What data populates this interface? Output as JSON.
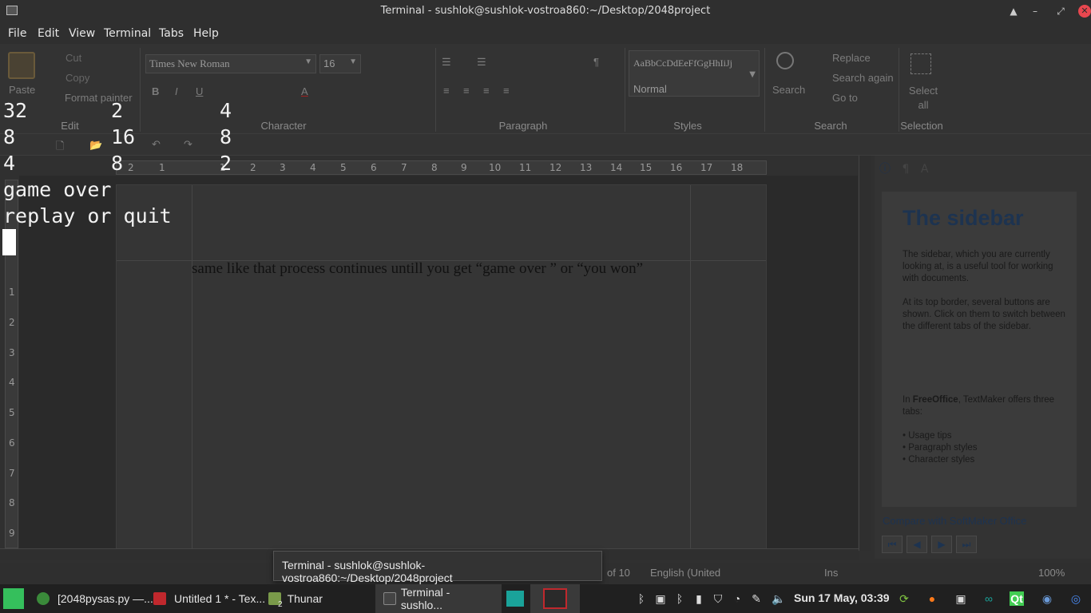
{
  "window": {
    "title": "Terminal - sushlok@sushlok-vostroa860:~/Desktop/2048project"
  },
  "menu": [
    "File",
    "Edit",
    "View",
    "Terminal",
    "Tabs",
    "Help"
  ],
  "ribbon": {
    "paste": "Paste",
    "cut": "Cut",
    "copy": "Copy",
    "format_painter": "Format painter",
    "font_name": "Times New Roman",
    "font_size": "16",
    "style_preview": "AaBbCcDdEeFfGgHhIiJj",
    "style_name": "Normal",
    "search": "Search",
    "replace": "Replace",
    "search_again": "Search again",
    "go_to": "Go to",
    "select_all": "Select all",
    "groups": {
      "edit": "Edit",
      "character": "Character",
      "paragraph": "Paragraph",
      "styles": "Styles",
      "search": "Search",
      "selection": "Selection"
    }
  },
  "ruler": {
    "h_ticks": [
      "2",
      "1",
      "1",
      "2",
      "3",
      "4",
      "5",
      "6",
      "7",
      "8",
      "9",
      "10",
      "11",
      "12",
      "13",
      "14",
      "15",
      "16",
      "17",
      "18"
    ],
    "v_ticks": [
      "1",
      "2",
      "3",
      "4",
      "5",
      "6",
      "7",
      "8",
      "9"
    ]
  },
  "document": {
    "text": "same like that process continues untill you get “game over ” or “you won”"
  },
  "sidebar": {
    "title": "The sidebar",
    "p1": "The sidebar, which you are currently looking at, is a useful tool for working with documents.",
    "p2": "At its top border, several buttons are shown. Click on them to switch between the different tabs of the sidebar.",
    "p3_prefix": "In ",
    "p3_bold": "FreeOffice",
    "p3_suffix": ", TextMaker offers three tabs:",
    "bullets": [
      "• Usage tips",
      "• Paragraph styles",
      "• Character styles"
    ],
    "link": "Compare with SoftMaker Office"
  },
  "statusbar": {
    "page": "of 10",
    "language": "English (United",
    "mode": "Ins",
    "zoom": "100%"
  },
  "terminal": {
    "grid": [
      [
        "32",
        "2",
        "4"
      ],
      [
        "8",
        "16",
        "8"
      ],
      [
        "4",
        "8",
        "2"
      ]
    ],
    "line1": "game over",
    "line2": "replay or quit"
  },
  "tooltip": "Terminal - sushlok@sushlok-vostroa860:~/Desktop/2048project",
  "taskbar": {
    "items": [
      {
        "label": "[2048pysas.py —..."
      },
      {
        "label": "Untitled 1 * - Tex..."
      },
      {
        "label": "Thunar"
      },
      {
        "label": "Terminal - sushlo..."
      }
    ],
    "thunar_badge": "2",
    "clock": "Sun 17 May, 03:39"
  },
  "colors": {
    "close_button": "#e8474f",
    "taskbar_bg": "#202020",
    "sidebar_title": "#1d3350"
  }
}
